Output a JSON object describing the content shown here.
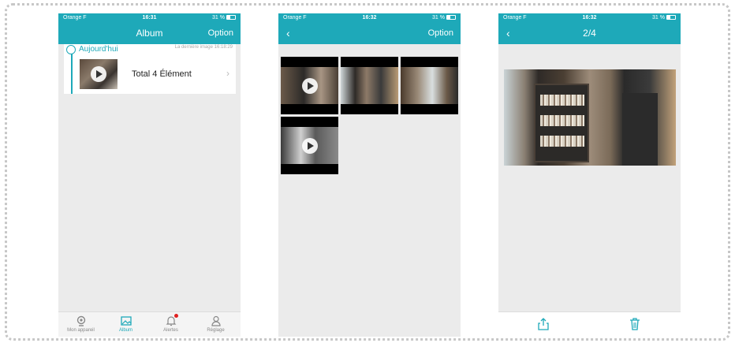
{
  "colors": {
    "accent": "#1ea9b9",
    "alert": "#e02020"
  },
  "screen1": {
    "status": {
      "carrier": "Orange F",
      "time": "16:31",
      "battery": "31 %"
    },
    "nav": {
      "title": "Album",
      "right": "Option"
    },
    "card": {
      "today": "Aujourd'hui",
      "last_image": "La dernière image  16:18:29",
      "total": "Total 4 Élément"
    },
    "tabs": [
      {
        "label": "Mon appareil",
        "icon": "camera-location-icon"
      },
      {
        "label": "Album",
        "icon": "photo-icon"
      },
      {
        "label": "Alertes",
        "icon": "bell-icon"
      },
      {
        "label": "Réglage",
        "icon": "person-icon"
      }
    ]
  },
  "screen2": {
    "status": {
      "carrier": "Orange F",
      "time": "16:32",
      "battery": "31 %"
    },
    "nav": {
      "back": "‹",
      "right": "Option"
    },
    "items": [
      {
        "video": true
      },
      {
        "video": false
      },
      {
        "video": false
      },
      {
        "video": true
      }
    ]
  },
  "screen3": {
    "status": {
      "carrier": "Orange F",
      "time": "16:32",
      "battery": "31 %"
    },
    "nav": {
      "back": "‹",
      "title": "2/4"
    },
    "toolbar": {
      "share_icon": "share-icon",
      "delete_icon": "trash-icon"
    }
  }
}
